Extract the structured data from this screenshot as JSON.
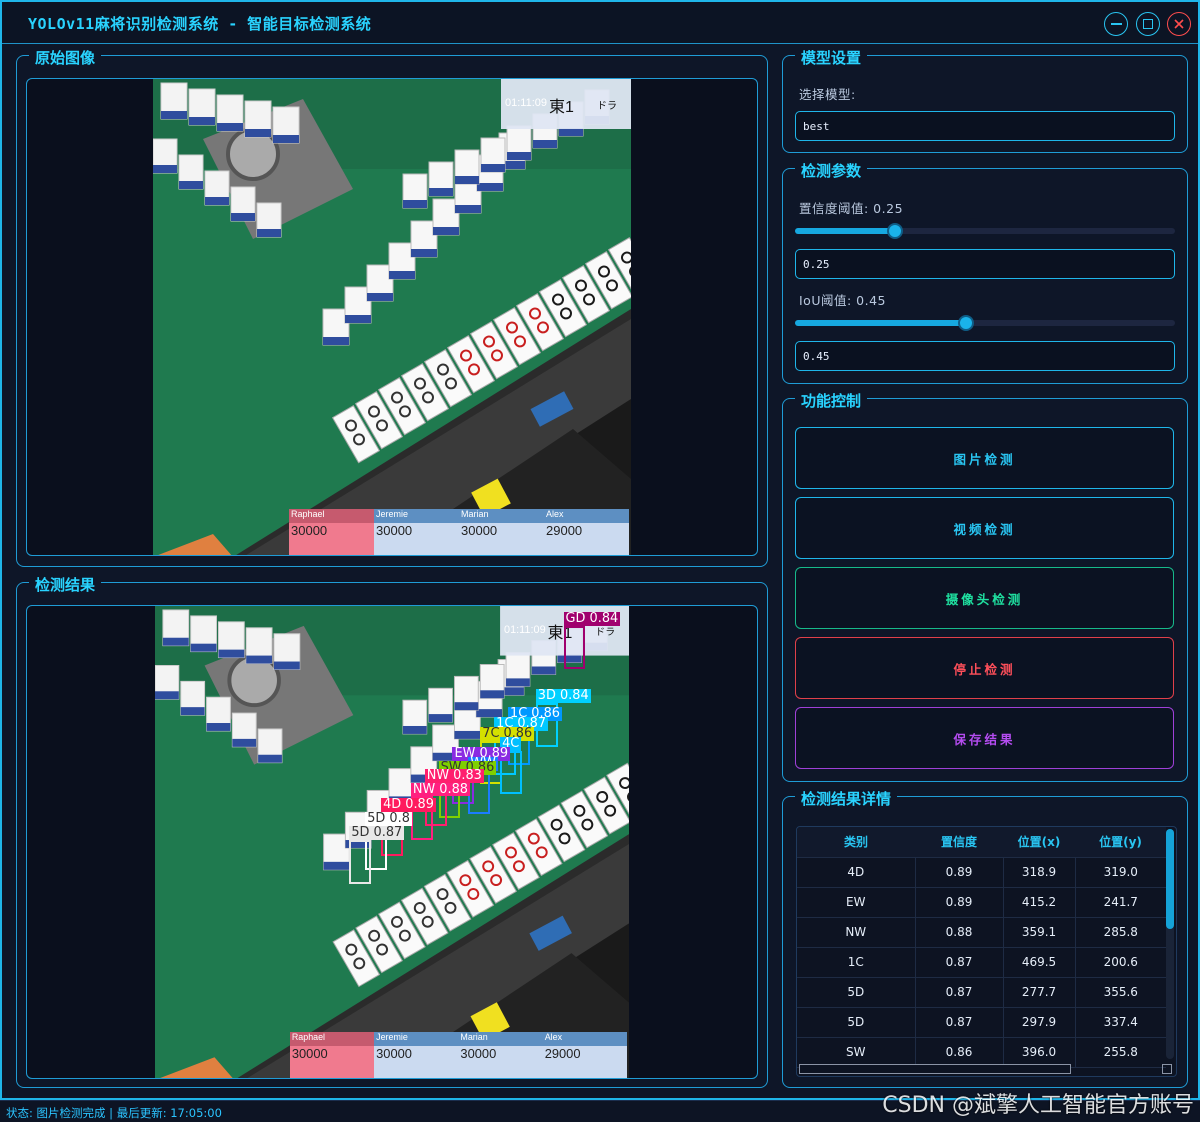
{
  "window": {
    "title": "YOLOv11麻将识别检测系统 - 智能目标检测系统"
  },
  "panels": {
    "original_title": "原始图像",
    "result_title": "检测结果",
    "model_title": "模型设置",
    "params_title": "检测参数",
    "control_title": "功能控制",
    "details_title": "检测结果详情"
  },
  "model": {
    "select_label": "选择模型:",
    "selected": "best"
  },
  "params": {
    "conf_label": "置信度阈值: 0.25",
    "conf_value": "0.25",
    "conf_level": 0.25,
    "iou_label": "IoU阈值: 0.45",
    "iou_value": "0.45",
    "iou_level": 0.45
  },
  "controls": {
    "image_detect": "图片检测",
    "video_detect": "视频检测",
    "camera_detect": "摄像头检测",
    "stop_detect": "停止检测",
    "save_result": "保存结果"
  },
  "scene": {
    "overlay_time": "01:11:09",
    "overlay_round": "東1",
    "overlay_dora": "ドラ",
    "players": [
      {
        "name": "Raphael",
        "score": "30000"
      },
      {
        "name": "Jeremie",
        "score": "30000"
      },
      {
        "name": "Marian",
        "score": "30000"
      },
      {
        "name": "Alex",
        "score": "29000"
      }
    ]
  },
  "detections": [
    {
      "label": "GD 0.84",
      "color": "#a0006e"
    },
    {
      "label": "3D 0.84",
      "color": "#00d0ff"
    },
    {
      "label": "1C 0.86",
      "color": "#0098ff"
    },
    {
      "label": "1C 0.87",
      "color": "#00c8ff"
    },
    {
      "label": "7C 0.86",
      "color": "#d4e000"
    },
    {
      "label": "4C",
      "color": "#00bfff"
    },
    {
      "label": "EW 0.89",
      "color": "#8a2be2"
    },
    {
      "label": "WW",
      "color": "#1c7cff"
    },
    {
      "label": "SW 0.86",
      "color": "#7fd000"
    },
    {
      "label": "NW 0.83",
      "color": "#ff1f6e"
    },
    {
      "label": "NW 0.88",
      "color": "#ff2080"
    },
    {
      "label": "4D 0.89",
      "color": "#ff1a5e"
    },
    {
      "label": "5D 0.8",
      "color": "#ffffff"
    },
    {
      "label": "5D 0.87",
      "color": "#e8e8e8"
    }
  ],
  "table": {
    "headers": [
      "类别",
      "置信度",
      "位置(x)",
      "位置(y)"
    ],
    "rows": [
      [
        "4D",
        "0.89",
        "318.9",
        "319.0"
      ],
      [
        "EW",
        "0.89",
        "415.2",
        "241.7"
      ],
      [
        "NW",
        "0.88",
        "359.1",
        "285.8"
      ],
      [
        "1C",
        "0.87",
        "469.5",
        "200.6"
      ],
      [
        "5D",
        "0.87",
        "277.7",
        "355.6"
      ],
      [
        "5D",
        "0.87",
        "297.9",
        "337.4"
      ],
      [
        "SW",
        "0.86",
        "396.0",
        "255.8"
      ]
    ]
  },
  "status": {
    "text": "状态: 图片检测完成 | 最后更新: 17:05:00"
  },
  "watermark": "CSDN @斌擎人工智能官方账号",
  "colors": {
    "accent": "#29d3ff",
    "border": "#1f9cd6",
    "camera_btn": "#1fe0a0",
    "stop_btn": "#ff4f5a",
    "save_btn": "#b44cf0"
  }
}
